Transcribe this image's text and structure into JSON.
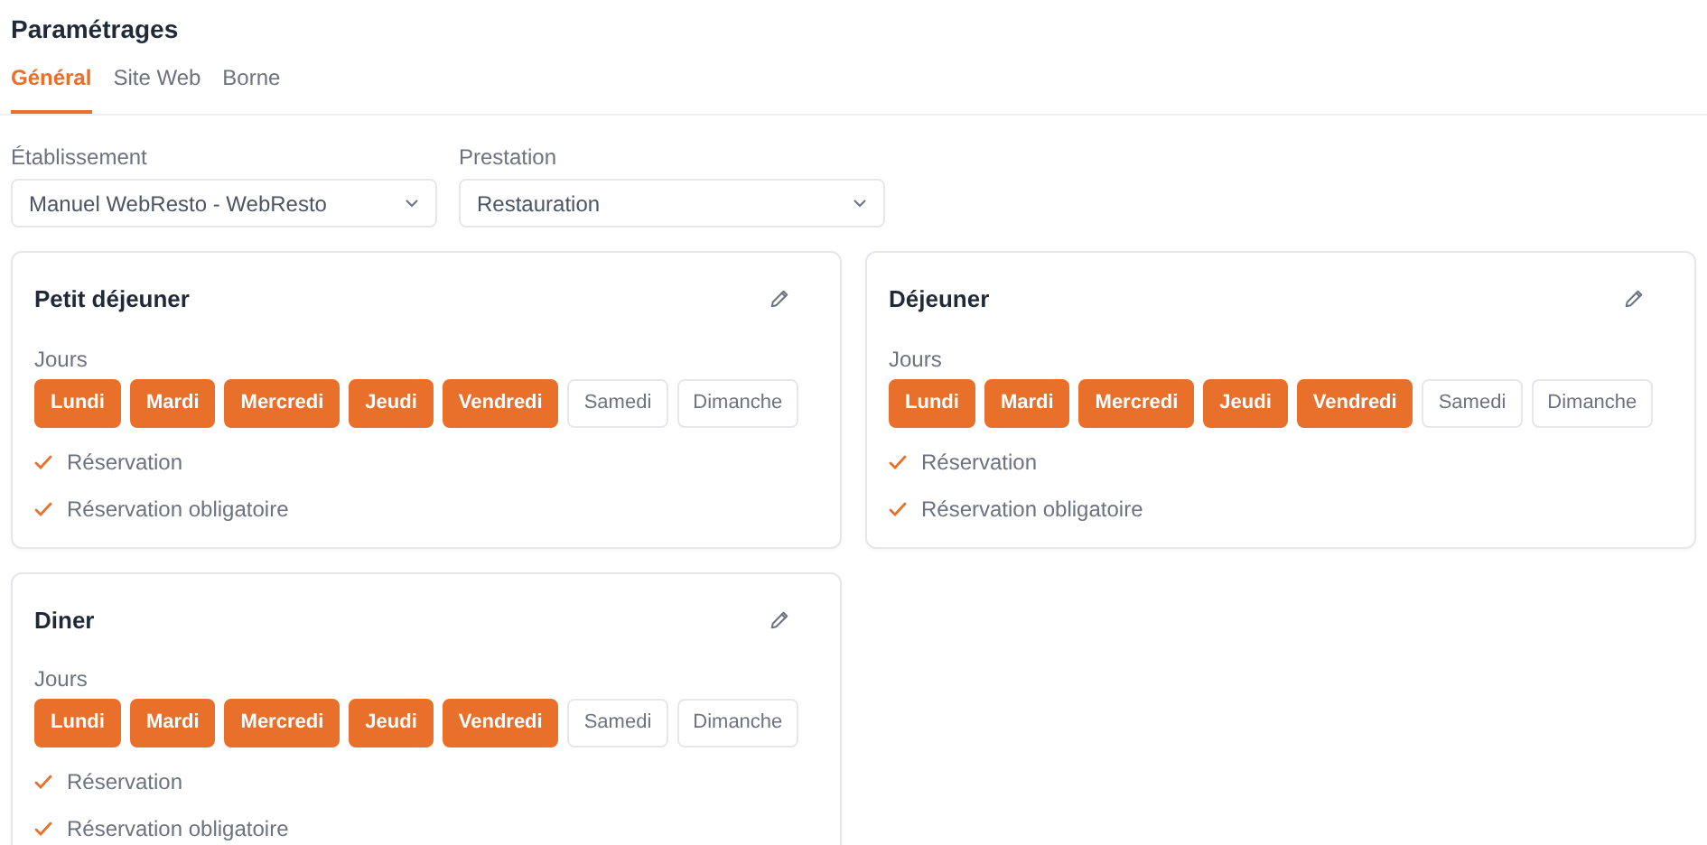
{
  "title": "Paramétrages",
  "tabs": [
    {
      "label": "Général",
      "selected": true
    },
    {
      "label": "Site Web",
      "selected": false
    },
    {
      "label": "Borne",
      "selected": false
    }
  ],
  "fields": [
    {
      "label": "Établissement",
      "value": "Manuel WebResto - WebResto"
    },
    {
      "label": "Prestation",
      "value": "Restauration"
    }
  ],
  "cards": [
    {
      "title": "Petit déjeuner",
      "days_label": "Jours",
      "days": [
        {
          "label": "Lundi",
          "selected": true
        },
        {
          "label": "Mardi",
          "selected": true
        },
        {
          "label": "Mercredi",
          "selected": true
        },
        {
          "label": "Jeudi",
          "selected": true
        },
        {
          "label": "Vendredi",
          "selected": true
        },
        {
          "label": "Samedi",
          "selected": false
        },
        {
          "label": "Dimanche",
          "selected": false
        }
      ],
      "options": [
        {
          "label": "Réservation",
          "checked": true
        },
        {
          "label": "Réservation obligatoire",
          "checked": true
        }
      ]
    },
    {
      "title": "Déjeuner",
      "days_label": "Jours",
      "days": [
        {
          "label": "Lundi",
          "selected": true
        },
        {
          "label": "Mardi",
          "selected": true
        },
        {
          "label": "Mercredi",
          "selected": true
        },
        {
          "label": "Jeudi",
          "selected": true
        },
        {
          "label": "Vendredi",
          "selected": true
        },
        {
          "label": "Samedi",
          "selected": false
        },
        {
          "label": "Dimanche",
          "selected": false
        }
      ],
      "options": [
        {
          "label": "Réservation",
          "checked": true
        },
        {
          "label": "Réservation obligatoire",
          "checked": true
        }
      ]
    },
    {
      "title": "Diner",
      "days_label": "Jours",
      "days": [
        {
          "label": "Lundi",
          "selected": true
        },
        {
          "label": "Mardi",
          "selected": true
        },
        {
          "label": "Mercredi",
          "selected": true
        },
        {
          "label": "Jeudi",
          "selected": true
        },
        {
          "label": "Vendredi",
          "selected": true
        },
        {
          "label": "Samedi",
          "selected": false
        },
        {
          "label": "Dimanche",
          "selected": false
        }
      ],
      "options": [
        {
          "label": "Réservation",
          "checked": true
        },
        {
          "label": "Réservation obligatoire",
          "checked": true
        }
      ]
    }
  ]
}
